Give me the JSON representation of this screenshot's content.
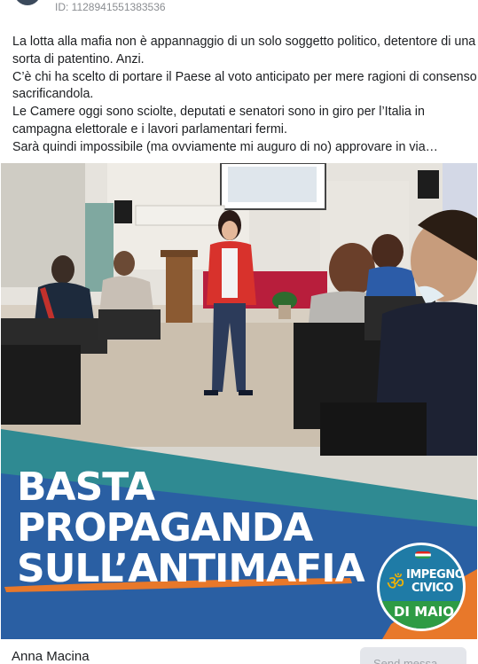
{
  "post": {
    "id_label": "ID: 1128941551383536",
    "text_lines": [
      "La lotta alla mafia non è appannaggio di un solo soggetto politico, detentore di una",
      "sorta di patentino. Anzi.",
      "C’è chi ha scelto di portare il Paese al voto anticipato per mere ragioni di consenso,",
      "sacrificandola.",
      "Le Camere oggi sono sciolte, deputati e senatori sono in giro per l’Italia in",
      "campagna elettorale e i lavori parlamentari fermi.",
      "Sarà quindi impossibile (ma ovviamente mi auguro di no) approvare in via…"
    ]
  },
  "image": {
    "banner_line1": "BASTA",
    "banner_line2": "PROPAGANDA",
    "banner_line3": "SULL’ANTIMAFIA",
    "logo_line1": "IMPEGNO",
    "logo_line2": "CIVICO",
    "logo_line3": "DI MAIO",
    "colors": {
      "banner_teal": "#2f8a92",
      "banner_blue": "#2a5fa3",
      "accent_orange": "#e8782a",
      "logo_blue": "#1f7ba6",
      "logo_green": "#2e9b44"
    }
  },
  "footer": {
    "author": "Anna Macina",
    "send_button": "Send messa"
  }
}
